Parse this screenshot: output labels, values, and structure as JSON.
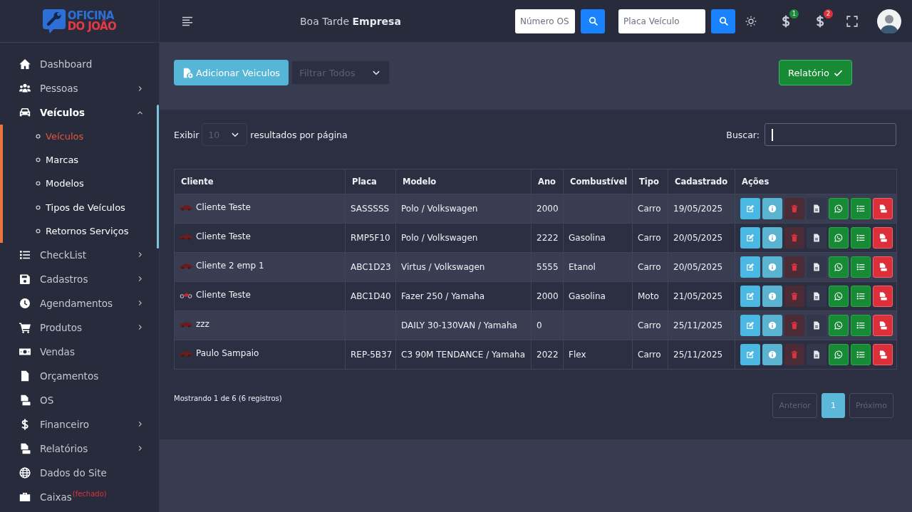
{
  "sidebar": {
    "logo": [
      {
        "text": "OFICINA",
        "color": "#2f6fd8"
      },
      {
        "text": "DO JOÃO",
        "color": "#e33a45"
      }
    ],
    "items": [
      {
        "label": "Dashboard",
        "selected": false
      },
      {
        "label": "Pessoas",
        "selected": false,
        "expanded": false
      },
      {
        "label": "Veículos",
        "selected": true,
        "expanded": true,
        "children": [
          {
            "label": "Veículos",
            "selected": true
          },
          {
            "label": "Marcas",
            "selected": false
          },
          {
            "label": "Modelos",
            "selected": false
          },
          {
            "label": "Tipos de Veículos",
            "selected": false
          },
          {
            "label": "Retornos Serviços",
            "selected": false
          }
        ]
      },
      {
        "label": "CheckList",
        "selected": false,
        "expanded": false
      },
      {
        "label": "Cadastros",
        "selected": false,
        "expanded": false
      },
      {
        "label": "Agendamentos",
        "selected": false,
        "expanded": false
      },
      {
        "label": "Produtos",
        "selected": false,
        "expanded": false
      },
      {
        "label": "Vendas",
        "selected": false
      },
      {
        "label": "Orçamentos",
        "selected": false
      },
      {
        "label": "OS",
        "selected": false
      },
      {
        "label": "Financeiro",
        "selected": false,
        "expanded": false
      },
      {
        "label": "Relatórios",
        "selected": false,
        "expanded": false
      },
      {
        "label": "Dados do Site",
        "selected": false
      },
      {
        "label": "Caixas",
        "note": "(fechado)",
        "selected": false
      }
    ]
  },
  "header": {
    "greeting": "Boa Tarde **Empresa**",
    "search_fields": [
      {
        "placeholder": "Número OS"
      },
      {
        "placeholder": "Placa Veículo"
      }
    ],
    "notifications": [
      {
        "count": "1",
        "color": "#1c8a3a"
      },
      {
        "count": "2",
        "color": "#dc2f3a"
      }
    ]
  },
  "toolbar": {
    "add_button": "Adicionar Veiculos",
    "filter": {
      "placeholder": "Filtrar Todos"
    },
    "report_button": "Relatório"
  },
  "table_controls": {
    "show_label": "Exibir",
    "page_size": "10",
    "per_page_label": "resultados por página",
    "search_label": "Buscar:",
    "search_focused": true
  },
  "table": {
    "columns": [
      "Cliente",
      "Placa",
      "Modelo",
      "Ano",
      "Combustível",
      "Tipo",
      "Cadastrado",
      "Ações"
    ],
    "rows": [
      {
        "kind": "car",
        "cliente": "Cliente Teste",
        "placa": "SASSSSS",
        "modelo": "Polo / Volkswagen",
        "ano": "2000",
        "tipo": "Carro",
        "cadastrado": "19/05/2025"
      },
      {
        "kind": "car",
        "cliente": "Cliente Teste",
        "placa": "RMP5F10",
        "modelo": "Polo / Volkswagen",
        "ano": "2222",
        "combustivel": "Gasolina",
        "tipo": "Carro",
        "cadastrado": "20/05/2025"
      },
      {
        "kind": "car",
        "cliente": "Cliente 2 emp 1",
        "placa": "ABC1D23",
        "modelo": "Virtus / Volkswagen",
        "ano": "5555",
        "combustivel": "Etanol",
        "tipo": "Carro",
        "cadastrado": "20/05/2025"
      },
      {
        "kind": "moto",
        "cliente": "Cliente Teste",
        "placa": "ABC1D40",
        "modelo": "Fazer 250 / Yamaha",
        "ano": "2000",
        "combustivel": "Gasolina",
        "tipo": "Moto",
        "cadastrado": "21/05/2025"
      },
      {
        "kind": "car",
        "cliente": "zzz",
        "modelo": "DAILY 30-130VAN / Yamaha",
        "ano": "0",
        "tipo": "Carro",
        "cadastrado": "25/11/2025"
      },
      {
        "kind": "car",
        "cliente": "Paulo Sampaio",
        "placa": "REP-5B37",
        "modelo": "C3 90M TENDANCE / Yamaha",
        "ano": "2022",
        "combustivel": "Flex",
        "tipo": "Carro",
        "cadastrado": "25/11/2025"
      }
    ]
  },
  "footer": {
    "info": "Mostrando 1 de 6 (6 registros)",
    "pages": [
      {
        "label": "Anterior",
        "selected": false,
        "disabled": true
      },
      {
        "label": "1",
        "selected": true,
        "disabled": false
      },
      {
        "label": "Próximo",
        "selected": false,
        "disabled": true
      }
    ]
  }
}
